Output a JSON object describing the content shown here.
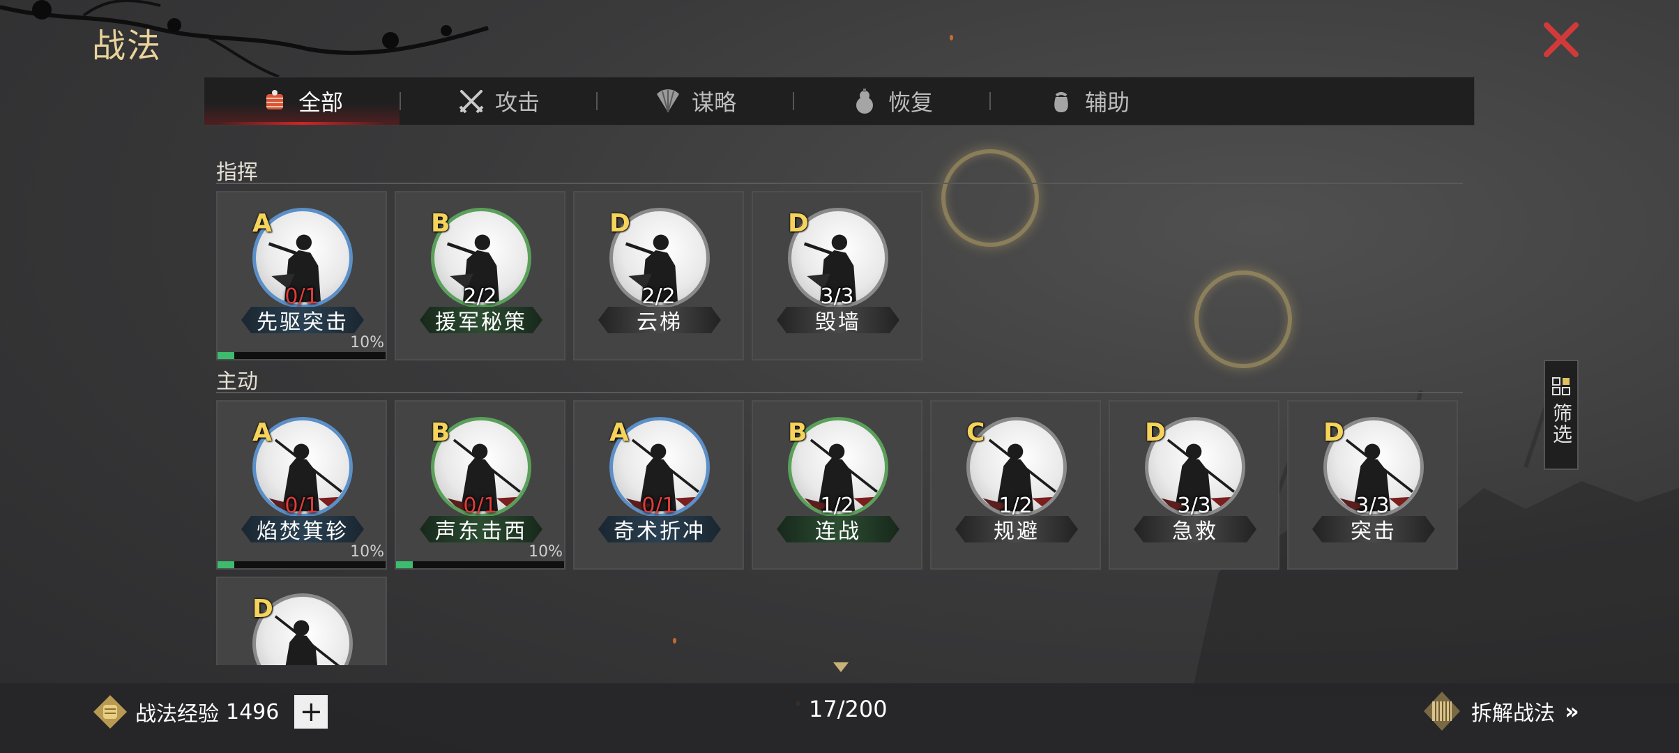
{
  "page": {
    "title": "战法"
  },
  "tabs": [
    {
      "label": "全部",
      "icon": "bundle-icon",
      "active": true
    },
    {
      "label": "攻击",
      "icon": "crossed-swords-icon",
      "active": false
    },
    {
      "label": "谋略",
      "icon": "fan-icon",
      "active": false
    },
    {
      "label": "恢复",
      "icon": "gourd-icon",
      "active": false
    },
    {
      "label": "辅助",
      "icon": "pouch-icon",
      "active": false
    }
  ],
  "sections": {
    "command": {
      "title": "指挥",
      "cards": [
        {
          "grade": "A",
          "count": "0/1",
          "count_red": true,
          "name": "先驱突击",
          "quality": "blue",
          "percent": "10%",
          "progress": 0.1
        },
        {
          "grade": "B",
          "count": "2/2",
          "count_red": false,
          "name": "援军秘策",
          "quality": "green"
        },
        {
          "grade": "D",
          "count": "2/2",
          "count_red": false,
          "name": "云梯",
          "quality": "gray"
        },
        {
          "grade": "D",
          "count": "3/3",
          "count_red": false,
          "name": "毁墙",
          "quality": "gray"
        }
      ]
    },
    "active": {
      "title": "主动",
      "cards": [
        {
          "grade": "A",
          "count": "0/1",
          "count_red": true,
          "name": "焰焚箕轸",
          "quality": "blue",
          "percent": "10%",
          "progress": 0.1
        },
        {
          "grade": "B",
          "count": "0/1",
          "count_red": true,
          "name": "声东击西",
          "quality": "green",
          "percent": "10%",
          "progress": 0.1
        },
        {
          "grade": "A",
          "count": "0/1",
          "count_red": true,
          "name": "奇术折冲",
          "quality": "blue"
        },
        {
          "grade": "B",
          "count": "1/2",
          "count_red": false,
          "name": "连战",
          "quality": "green"
        },
        {
          "grade": "C",
          "count": "1/2",
          "count_red": false,
          "name": "规避",
          "quality": "gray"
        },
        {
          "grade": "D",
          "count": "3/3",
          "count_red": false,
          "name": "急救",
          "quality": "gray"
        },
        {
          "grade": "D",
          "count": "3/3",
          "count_red": false,
          "name": "突击",
          "quality": "gray"
        },
        {
          "grade": "D",
          "count": "",
          "count_red": false,
          "name": "",
          "quality": "gray"
        }
      ]
    }
  },
  "filter": {
    "label": "筛选",
    "icon": "grid-icon"
  },
  "footer": {
    "exp_label": "战法经验",
    "exp_value": "1496",
    "plus_label": "+",
    "capacity": "17/200",
    "dismantle_label": "拆解战法",
    "dismantle_arrow": "»"
  },
  "colors": {
    "grade": "#f6d35a",
    "count_red": "#e23b3b",
    "progress": "#3dbb6e",
    "tab_active_underline": "#d02525",
    "close": "#d23a3a"
  }
}
